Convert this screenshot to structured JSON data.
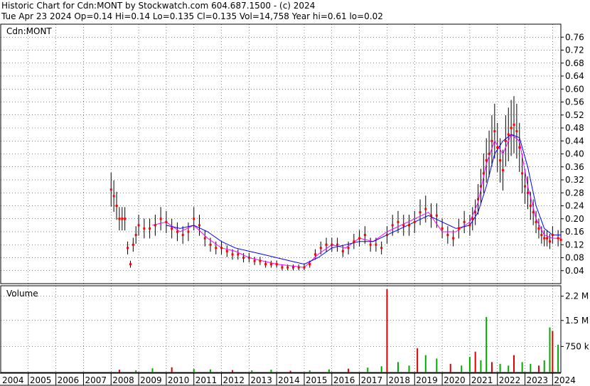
{
  "header": {
    "line1": "Historic Chart for Cdn:MONT by Stockwatch.com 604.687.1500 - (c) 2024",
    "line2": "Tue Apr 23 2024   Op=0.14  Hi=0.14  Lo=0.135  Cl=0.135  Vol=14,758  Year hi=0.61  lo=0.02"
  },
  "colors": {
    "price_bar": "#000000",
    "close_marker": "#ff0000",
    "ma_short": "#ff00ff",
    "ma_long": "#0000ff",
    "volume_up": "#00aa00",
    "volume_down": "#dd0000",
    "grid": "#000000"
  },
  "chart_data": [
    {
      "type": "line",
      "title": "Cdn:MONT",
      "x_unit": "year",
      "ylim": [
        0,
        0.8
      ],
      "yticks": [
        "0.76",
        "0.72",
        "0.68",
        "0.64",
        "0.60",
        "0.56",
        "0.52",
        "0.48",
        "0.44",
        "0.40",
        "0.36",
        "0.32",
        "0.28",
        "0.24",
        "0.20",
        "0.16",
        "0.12",
        "0.08",
        "0.04"
      ],
      "x_year_labels": [
        "2004",
        "2005",
        "2006",
        "2007",
        "2008",
        "2009",
        "2010",
        "2011",
        "2012",
        "2013",
        "2014",
        "2015",
        "2016",
        "2017",
        "2018",
        "2019",
        "2020",
        "2021",
        "2022",
        "2023",
        "2024"
      ],
      "grid": true,
      "series": [
        {
          "role": "price",
          "x": [
            2008.0,
            2008.1,
            2008.2,
            2008.3,
            2008.4,
            2008.5,
            2008.6,
            2008.7,
            2008.8,
            2008.9,
            2009.0,
            2009.2,
            2009.4,
            2009.6,
            2009.8,
            2010.0,
            2010.2,
            2010.4,
            2010.6,
            2010.8,
            2011.0,
            2011.2,
            2011.4,
            2011.6,
            2011.8,
            2012.0,
            2012.2,
            2012.4,
            2012.6,
            2012.8,
            2013.0,
            2013.2,
            2013.4,
            2013.6,
            2013.8,
            2014.0,
            2014.2,
            2014.4,
            2014.6,
            2014.8,
            2015.0,
            2015.2,
            2015.4,
            2015.6,
            2015.8,
            2016.0,
            2016.2,
            2016.4,
            2016.6,
            2016.8,
            2017.0,
            2017.2,
            2017.4,
            2017.6,
            2017.8,
            2018.0,
            2018.2,
            2018.4,
            2018.6,
            2018.8,
            2019.0,
            2019.2,
            2019.4,
            2019.6,
            2019.8,
            2020.0,
            2020.2,
            2020.4,
            2020.6,
            2020.8,
            2021.0,
            2021.1,
            2021.2,
            2021.3,
            2021.4,
            2021.5,
            2021.6,
            2021.7,
            2021.8,
            2021.9,
            2022.0,
            2022.1,
            2022.2,
            2022.3,
            2022.4,
            2022.5,
            2022.6,
            2022.7,
            2022.8,
            2022.9,
            2023.0,
            2023.1,
            2023.2,
            2023.3,
            2023.4,
            2023.5,
            2023.6,
            2023.7,
            2023.8,
            2023.9,
            2024.0,
            2024.2,
            2024.3
          ],
          "y": [
            0.29,
            0.27,
            0.24,
            0.2,
            0.2,
            0.2,
            0.11,
            0.06,
            0.12,
            0.15,
            0.18,
            0.17,
            0.17,
            0.18,
            0.2,
            0.19,
            0.17,
            0.16,
            0.15,
            0.16,
            0.2,
            0.18,
            0.14,
            0.12,
            0.11,
            0.11,
            0.1,
            0.09,
            0.09,
            0.08,
            0.08,
            0.07,
            0.07,
            0.06,
            0.06,
            0.06,
            0.05,
            0.05,
            0.05,
            0.05,
            0.05,
            0.06,
            0.09,
            0.11,
            0.12,
            0.12,
            0.12,
            0.1,
            0.11,
            0.13,
            0.14,
            0.15,
            0.12,
            0.12,
            0.11,
            0.15,
            0.18,
            0.19,
            0.18,
            0.18,
            0.19,
            0.22,
            0.23,
            0.21,
            0.21,
            0.17,
            0.15,
            0.14,
            0.17,
            0.19,
            0.18,
            0.2,
            0.22,
            0.26,
            0.3,
            0.34,
            0.38,
            0.4,
            0.44,
            0.47,
            0.42,
            0.38,
            0.35,
            0.44,
            0.46,
            0.48,
            0.49,
            0.47,
            0.42,
            0.34,
            0.3,
            0.28,
            0.24,
            0.22,
            0.19,
            0.17,
            0.15,
            0.14,
            0.14,
            0.13,
            0.15,
            0.14,
            0.135
          ]
        },
        {
          "role": "ma_short",
          "x": [
            2009.5,
            2010.0,
            2010.5,
            2011.0,
            2011.5,
            2012.0,
            2012.5,
            2013.0,
            2013.5,
            2014.0,
            2014.5,
            2015.0,
            2015.5,
            2016.0,
            2016.5,
            2017.0,
            2017.5,
            2018.0,
            2018.5,
            2019.0,
            2019.5,
            2020.0,
            2020.5,
            2021.0,
            2021.3,
            2021.6,
            2021.9,
            2022.2,
            2022.5,
            2022.8,
            2023.1,
            2023.4,
            2023.7,
            2024.0,
            2024.3
          ],
          "y": [
            0.18,
            0.19,
            0.16,
            0.18,
            0.14,
            0.11,
            0.1,
            0.08,
            0.07,
            0.06,
            0.055,
            0.05,
            0.09,
            0.12,
            0.11,
            0.14,
            0.13,
            0.16,
            0.18,
            0.2,
            0.22,
            0.16,
            0.16,
            0.19,
            0.25,
            0.37,
            0.44,
            0.4,
            0.46,
            0.44,
            0.3,
            0.2,
            0.15,
            0.14,
            0.14
          ]
        },
        {
          "role": "ma_long",
          "x": [
            2010.0,
            2010.5,
            2011.0,
            2011.5,
            2012.0,
            2012.5,
            2013.0,
            2013.5,
            2014.0,
            2014.5,
            2015.0,
            2015.5,
            2016.0,
            2016.5,
            2017.0,
            2017.5,
            2018.0,
            2018.5,
            2019.0,
            2019.5,
            2020.0,
            2020.5,
            2021.0,
            2021.3,
            2021.6,
            2021.9,
            2022.2,
            2022.5,
            2022.8,
            2023.1,
            2023.4,
            2023.7,
            2024.0,
            2024.3
          ],
          "y": [
            0.18,
            0.17,
            0.18,
            0.16,
            0.13,
            0.11,
            0.1,
            0.09,
            0.08,
            0.07,
            0.06,
            0.08,
            0.11,
            0.12,
            0.13,
            0.13,
            0.15,
            0.17,
            0.19,
            0.21,
            0.19,
            0.17,
            0.18,
            0.22,
            0.3,
            0.4,
            0.44,
            0.46,
            0.45,
            0.36,
            0.24,
            0.17,
            0.15,
            0.15
          ]
        }
      ]
    },
    {
      "type": "bar",
      "title": "Volume",
      "yticks": [
        "2.2 M",
        "1.5 M",
        "750 k"
      ],
      "ylim": [
        0,
        2500000
      ],
      "series": [
        {
          "role": "volume",
          "x": [
            2008.3,
            2008.9,
            2009.5,
            2010.2,
            2011.0,
            2011.6,
            2012.4,
            2013.1,
            2013.8,
            2014.5,
            2015.2,
            2015.9,
            2016.6,
            2017.3,
            2017.8,
            2018.0,
            2018.4,
            2018.8,
            2019.1,
            2019.4,
            2019.8,
            2020.3,
            2020.7,
            2021.0,
            2021.2,
            2021.4,
            2021.6,
            2021.8,
            2022.1,
            2022.4,
            2022.6,
            2022.9,
            2023.2,
            2023.5,
            2023.7,
            2023.9,
            2024.0,
            2024.2
          ],
          "y": [
            80000,
            60000,
            120000,
            150000,
            100000,
            90000,
            70000,
            60000,
            80000,
            50000,
            60000,
            90000,
            110000,
            140000,
            180000,
            2400000,
            300000,
            200000,
            700000,
            500000,
            400000,
            250000,
            200000,
            450000,
            600000,
            350000,
            1600000,
            300000,
            250000,
            200000,
            500000,
            300000,
            250000,
            200000,
            350000,
            1300000,
            1200000,
            800000
          ]
        }
      ]
    }
  ]
}
